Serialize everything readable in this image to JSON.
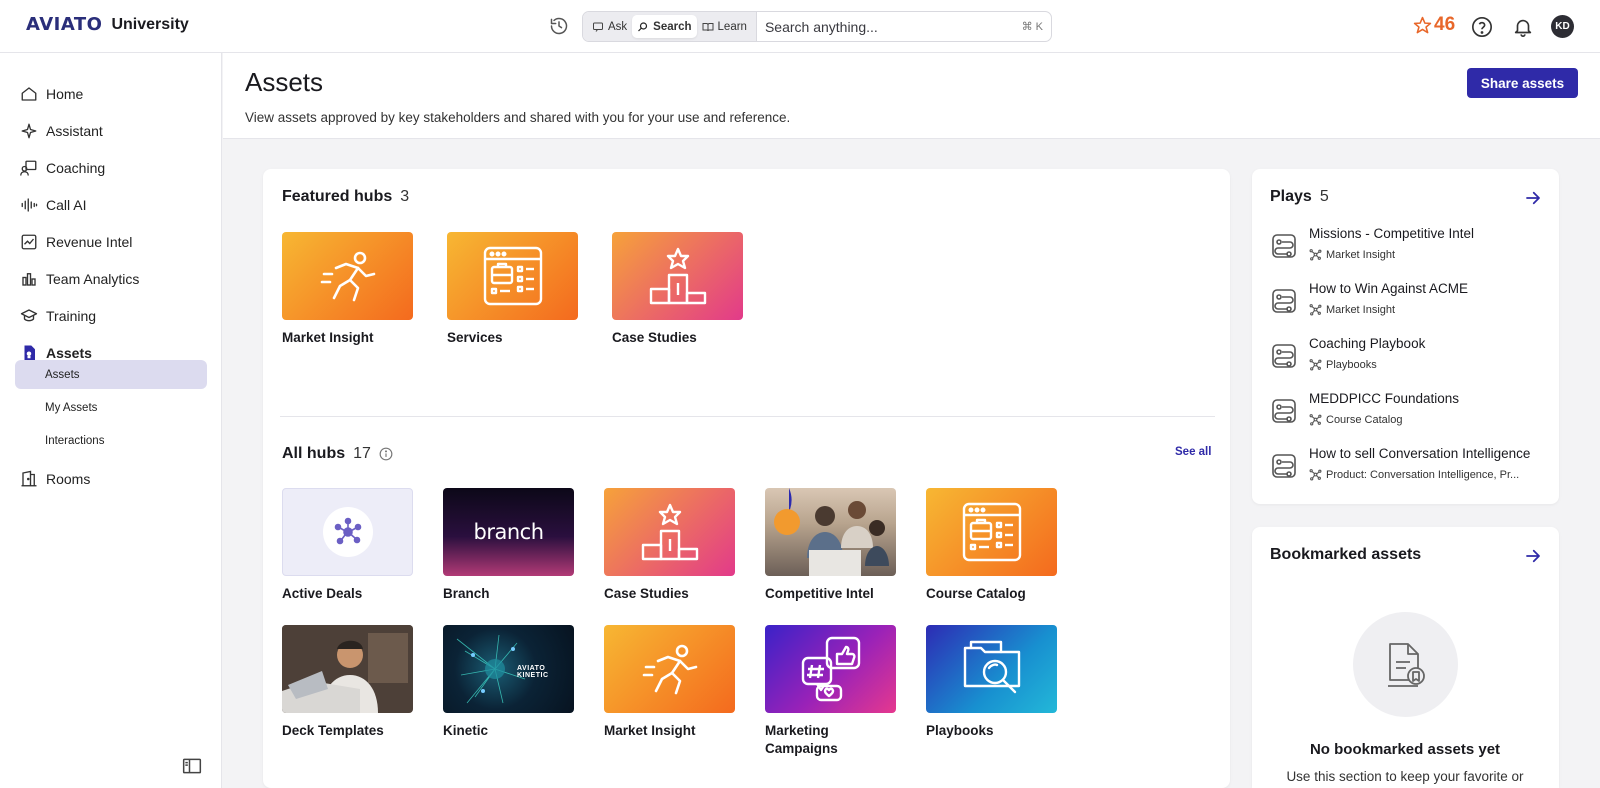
{
  "brand": {
    "logo": "AVIATO",
    "name": "University"
  },
  "search": {
    "modes": [
      {
        "label": "Ask"
      },
      {
        "label": "Search"
      },
      {
        "label": "Learn"
      }
    ],
    "placeholder": "Search anything...",
    "shortcut": "⌘ K"
  },
  "user": {
    "points": "46",
    "initials": "KD"
  },
  "sidebar": {
    "items": [
      {
        "label": "Home",
        "icon": "home-icon"
      },
      {
        "label": "Assistant",
        "icon": "sparkle-icon"
      },
      {
        "label": "Coaching",
        "icon": "coaching-icon"
      },
      {
        "label": "Call AI",
        "icon": "waveform-icon"
      },
      {
        "label": "Revenue Intel",
        "icon": "chart-icon"
      },
      {
        "label": "Team Analytics",
        "icon": "bar-chart-icon"
      },
      {
        "label": "Training",
        "icon": "graduation-cap-icon"
      },
      {
        "label": "Assets",
        "icon": "assets-icon"
      },
      {
        "label": "Rooms",
        "icon": "rooms-icon"
      }
    ],
    "sub_items": [
      {
        "label": "Assets"
      },
      {
        "label": "My Assets"
      },
      {
        "label": "Interactions"
      }
    ]
  },
  "page": {
    "title": "Assets",
    "description": "View assets approved by key stakeholders and shared with you for your use and reference.",
    "share_label": "Share assets"
  },
  "featured": {
    "title": "Featured hubs",
    "count": "3",
    "hubs": [
      {
        "label": "Market Insight"
      },
      {
        "label": "Services"
      },
      {
        "label": "Case Studies"
      }
    ]
  },
  "all_hubs": {
    "title": "All hubs",
    "count": "17",
    "see_all": "See all",
    "branch_logo": "branch",
    "kinetic_logo": "AVIATO KINETIC",
    "hubs": [
      {
        "label": "Active Deals"
      },
      {
        "label": "Branch"
      },
      {
        "label": "Case Studies"
      },
      {
        "label": "Competitive Intel"
      },
      {
        "label": "Course Catalog"
      },
      {
        "label": "Deck Templates"
      },
      {
        "label": "Kinetic"
      },
      {
        "label": "Market Insight"
      },
      {
        "label": "Marketing Campaigns"
      },
      {
        "label": "Playbooks"
      }
    ]
  },
  "plays": {
    "title": "Plays",
    "count": "5",
    "items": [
      {
        "title": "Missions - Competitive Intel",
        "hub": "Market Insight"
      },
      {
        "title": "How to Win Against ACME",
        "hub": "Market Insight"
      },
      {
        "title": "Coaching Playbook",
        "hub": "Playbooks"
      },
      {
        "title": "MEDDPICC Foundations",
        "hub": "Course Catalog"
      },
      {
        "title": "How to sell Conversation Intelligence",
        "hub": "Product: Conversation Intelligence, Pr..."
      }
    ]
  },
  "bookmarked": {
    "title": "Bookmarked assets",
    "empty_title": "No bookmarked assets yet",
    "empty_desc": "Use this section to keep your favorite or"
  },
  "colors": {
    "accent": "#2f2aa8",
    "points": "#e8672a",
    "selected_nav": "#dcdbef"
  }
}
